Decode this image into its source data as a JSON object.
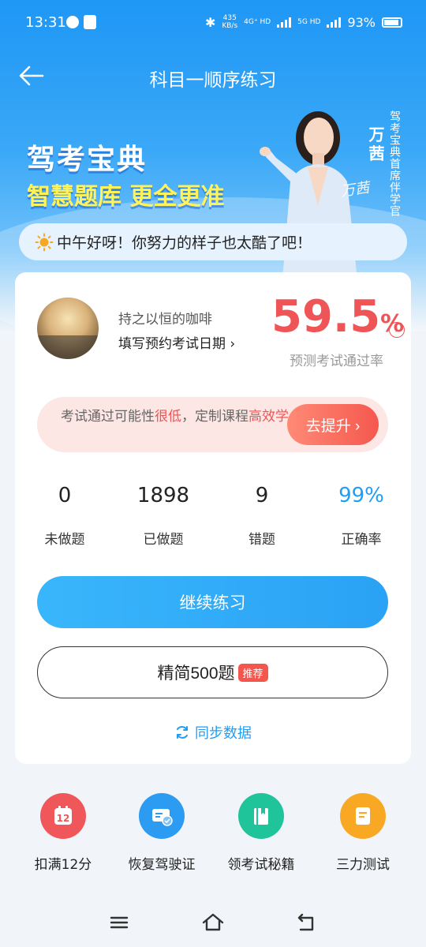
{
  "status_bar": {
    "time": "13:31",
    "speed_value": "435",
    "speed_unit": "KB/s",
    "net1": "4G⁺ HD",
    "net2": "5G HD",
    "battery": "93%"
  },
  "nav": {
    "title": "科目一顺序练习"
  },
  "banner": {
    "title": "驾考宝典",
    "subtitle": "智慧题库 更全更准",
    "person_name": "万茜",
    "person_role": "驾考宝典首席伴学官",
    "signature": "万茜"
  },
  "greeting": {
    "text": "中午好呀！你努力的样子也太酷了吧！"
  },
  "profile": {
    "nickname": "持之以恒的咖啡",
    "exam_date_link": "填写预约考试日期 ›"
  },
  "pass_rate": {
    "value": "59.5",
    "unit": "%",
    "label": "预测考试通过率"
  },
  "hint": {
    "text_a": "考试通过可能性",
    "text_low": "很低",
    "text_b": "，定制课程",
    "text_high": "高效学",
    "button": "去提升 ›"
  },
  "stats": [
    {
      "value": "0",
      "label": "未做题"
    },
    {
      "value": "1898",
      "label": "已做题"
    },
    {
      "value": "9",
      "label": "错题"
    },
    {
      "value": "99%",
      "label": "正确率"
    }
  ],
  "buttons": {
    "continue": "继续练习",
    "simple": "精简500题",
    "simple_badge": "推荐",
    "sync": "同步数据"
  },
  "quick_actions": [
    {
      "label": "扣满12分",
      "icon": "calendar-12-icon",
      "color": "#f0575a",
      "badge": "12"
    },
    {
      "label": "恢复驾驶证",
      "icon": "license-card-icon",
      "color": "#2b9cf2"
    },
    {
      "label": "领考试秘籍",
      "icon": "book-icon",
      "color": "#1fc49a"
    },
    {
      "label": "三力测试",
      "icon": "document-icon",
      "color": "#f8a823"
    }
  ],
  "colors": {
    "accent": "#1f9ef5",
    "danger": "#ef5556",
    "header_top": "#1e97f5"
  }
}
